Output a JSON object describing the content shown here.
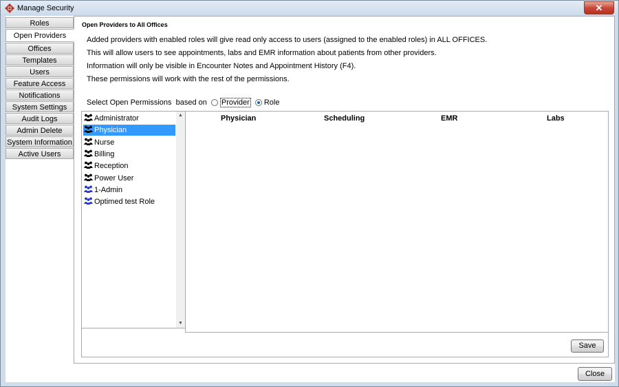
{
  "window": {
    "title": "Manage Security",
    "close_glyph": "✕"
  },
  "nav": {
    "items": [
      {
        "label": "Roles",
        "active": false
      },
      {
        "label": "Open Providers",
        "active": true
      },
      {
        "label": "Offices",
        "active": false
      },
      {
        "label": "Templates",
        "active": false
      },
      {
        "label": "Users",
        "active": false
      },
      {
        "label": "Feature Access",
        "active": false
      },
      {
        "label": "Notifications",
        "active": false
      },
      {
        "label": "System Settings",
        "active": false
      },
      {
        "label": "Audit Logs",
        "active": false
      },
      {
        "label": "Admin Delete",
        "active": false
      },
      {
        "label": "System Information",
        "active": false
      },
      {
        "label": "Active Users",
        "active": false
      }
    ]
  },
  "content": {
    "heading": "Open Providers to All Offices",
    "lines": [
      "Added providers with enabled roles will give read only access to users (assigned to the enabled roles) in ALL OFFICES.",
      "This will allow users to see appointments, labs and EMR information about patients from other providers.",
      "Information will only be visible in Encounter Notes and Appointment History (F4).",
      "These permissions will work with the rest of the permissions."
    ],
    "permissions": {
      "label": "Select Open Permissions  based on",
      "options": [
        {
          "label": "Provider",
          "selected": false
        },
        {
          "label": "Role",
          "selected": true
        }
      ]
    },
    "roles": [
      {
        "label": "Administrator",
        "selected": false,
        "icon": "group-icon-black"
      },
      {
        "label": "Physician",
        "selected": true,
        "icon": "group-icon-black"
      },
      {
        "label": "Nurse",
        "selected": false,
        "icon": "group-icon-black"
      },
      {
        "label": "Billing",
        "selected": false,
        "icon": "group-icon-black"
      },
      {
        "label": "Reception",
        "selected": false,
        "icon": "group-icon-black"
      },
      {
        "label": "Power User",
        "selected": false,
        "icon": "group-icon-black"
      },
      {
        "label": "1-Admin",
        "selected": false,
        "icon": "group-icon-blue"
      },
      {
        "label": "Optimed test Role",
        "selected": false,
        "icon": "group-icon-blue"
      }
    ],
    "columns": [
      "Physician",
      "Scheduling",
      "EMR",
      "Labs"
    ],
    "save_label": "Save"
  },
  "footer": {
    "close_label": "Close"
  },
  "colors": {
    "selection": "#3399ff",
    "blue_icon": "#2233cc",
    "titlebar": "#cbd9ea"
  }
}
